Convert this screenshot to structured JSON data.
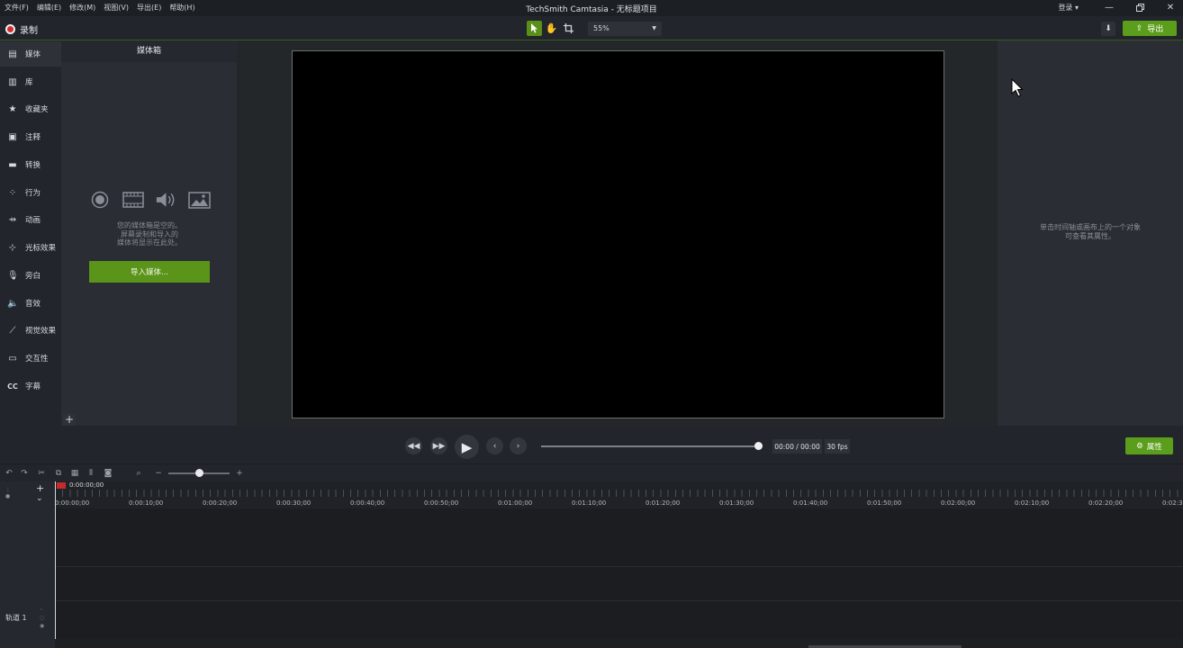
{
  "titlebar": {
    "menu": [
      "文件(F)",
      "编辑(E)",
      "修改(M)",
      "视图(V)",
      "导出(E)",
      "帮助(H)"
    ],
    "app_title": "TechSmith Camtasia - 无标题项目",
    "login": "登录 ▾"
  },
  "toolbar": {
    "record_label": "录制",
    "zoom_value": "55%",
    "export_label": "导出"
  },
  "sidebar": {
    "items": [
      {
        "label": "媒体",
        "icon": "media-icon"
      },
      {
        "label": "库",
        "icon": "library-icon"
      },
      {
        "label": "收藏夹",
        "icon": "star-icon"
      },
      {
        "label": "注释",
        "icon": "annotation-icon"
      },
      {
        "label": "转换",
        "icon": "transition-icon"
      },
      {
        "label": "行为",
        "icon": "behavior-icon"
      },
      {
        "label": "动画",
        "icon": "animation-icon"
      },
      {
        "label": "光标效果",
        "icon": "cursor-effect-icon"
      },
      {
        "label": "旁白",
        "icon": "microphone-icon"
      },
      {
        "label": "音效",
        "icon": "speaker-icon"
      },
      {
        "label": "视觉效果",
        "icon": "wand-icon"
      },
      {
        "label": "交互性",
        "icon": "interactive-icon"
      },
      {
        "label": "字幕",
        "icon": "cc-icon"
      }
    ]
  },
  "media_bin": {
    "title": "媒体箱",
    "empty_line1": "您的媒体箱是空的。",
    "empty_line2": "屏幕录制和导入的",
    "empty_line3": "媒体将显示在此处。",
    "import_button": "导入媒体..."
  },
  "properties": {
    "hint_line1": "单击时间轴或画布上的一个对象",
    "hint_line2": "可查看其属性。",
    "button": "属性"
  },
  "playback": {
    "time": "00:00 / 00:00",
    "fps": "30 fps"
  },
  "timeline": {
    "playhead_time": "0:00:00;00",
    "ticks": [
      "0:00:00;00",
      "0:00:10;00",
      "0:00:20;00",
      "0:00:30;00",
      "0:00:40;00",
      "0:00:50;00",
      "0:01:00;00",
      "0:01:10;00",
      "0:01:20;00",
      "0:01:30;00",
      "0:01:40;00",
      "0:01:50;00",
      "0:02:00;00",
      "0:02:10;00",
      "0:02:20;00",
      "0:02:3"
    ],
    "track_label": "轨道 1"
  },
  "colors": {
    "accent_green": "#5a9e1b",
    "record_red": "#d52d2d",
    "background": "#22252b"
  }
}
